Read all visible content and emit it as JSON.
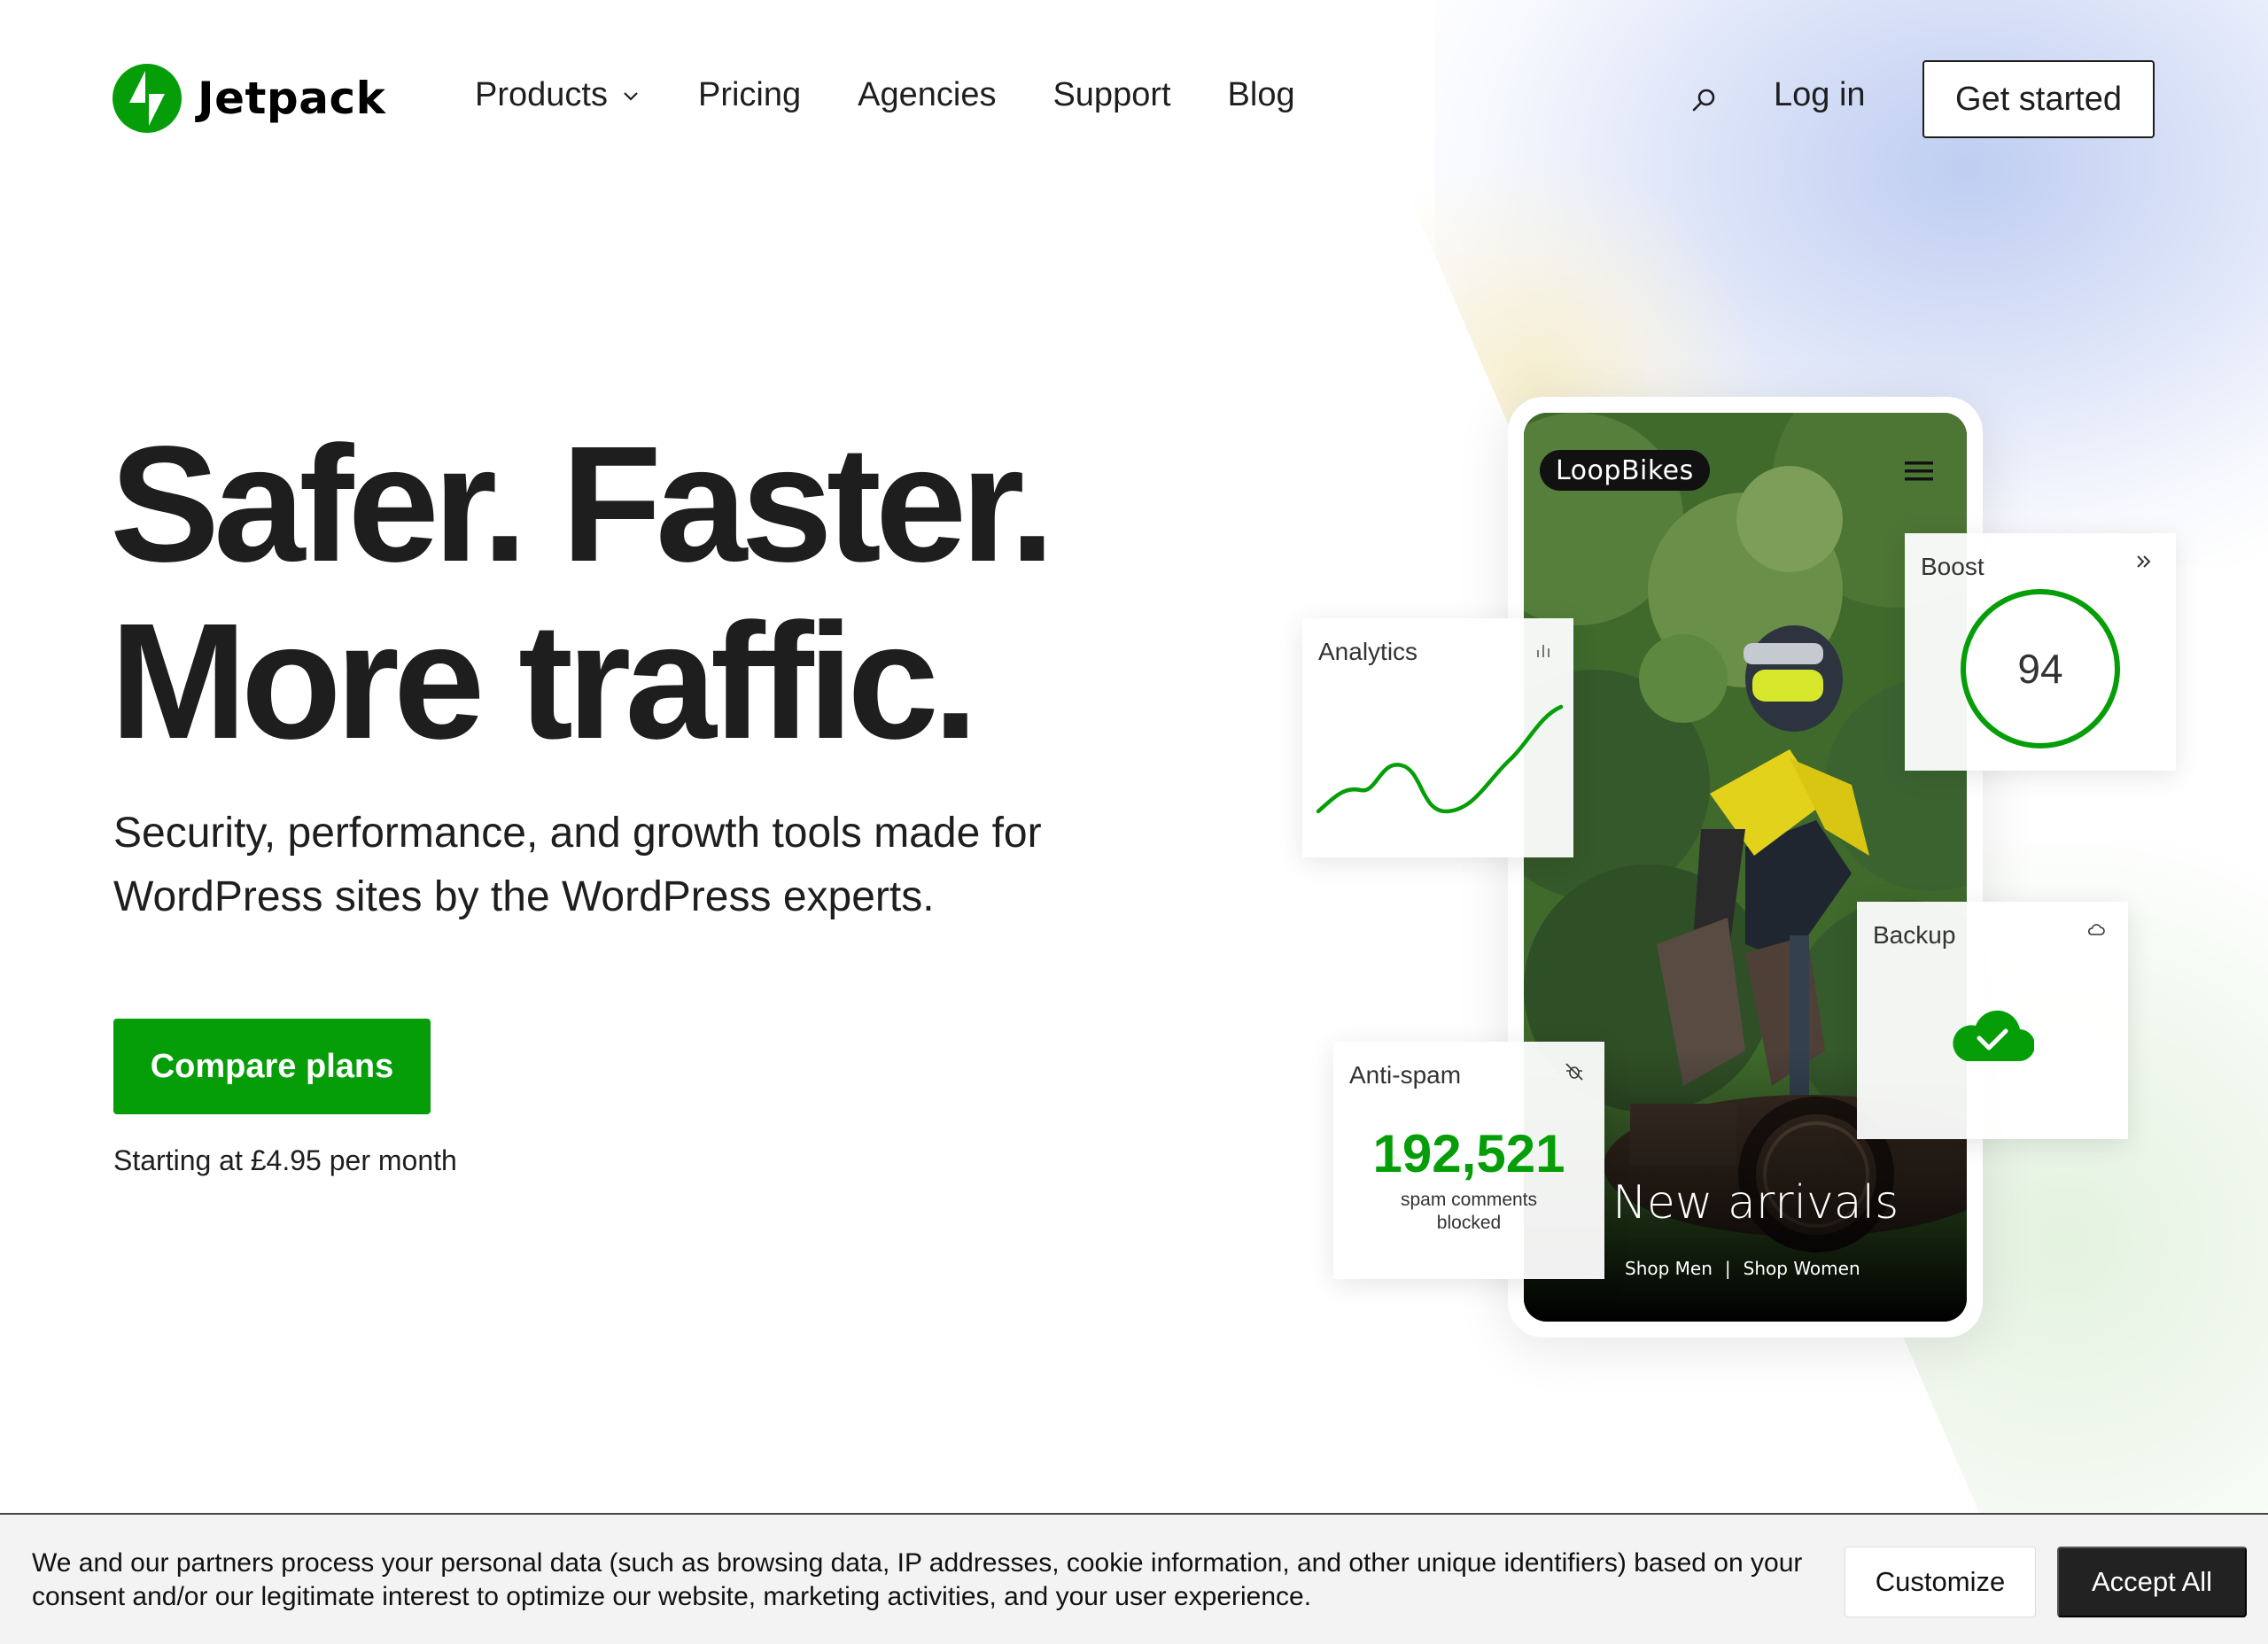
{
  "brand": {
    "name": "Jetpack",
    "accent": "#069e08"
  },
  "nav": {
    "items": [
      {
        "label": "Products",
        "has_dropdown": true
      },
      {
        "label": "Pricing"
      },
      {
        "label": "Agencies"
      },
      {
        "label": "Support"
      },
      {
        "label": "Blog"
      }
    ],
    "login": "Log in",
    "get_started": "Get started"
  },
  "hero": {
    "title_line1": "Safer. Faster.",
    "title_line2": "More traffic.",
    "subtitle_line1": "Security, performance, and growth tools made for",
    "subtitle_line2": "WordPress sites by the WordPress experts.",
    "cta": "Compare plans",
    "price_note": "Starting at £4.95 per month"
  },
  "mockup": {
    "store_name": "LoopBikes",
    "headline": "New arrivals",
    "link_men": "Shop Men",
    "separator": "|",
    "link_women": "Shop Women"
  },
  "cards": {
    "analytics": {
      "title": "Analytics",
      "icon": "bar-chart-icon"
    },
    "boost": {
      "title": "Boost",
      "score": "94",
      "score_percent": 100,
      "icon": "chevrons-right-icon"
    },
    "backup": {
      "title": "Backup",
      "icon": "cloud-icon"
    },
    "antispam": {
      "title": "Anti-spam",
      "count": "192,521",
      "label": "spam comments blocked",
      "icon": "spam-bug-icon"
    }
  },
  "cookie": {
    "text": "We and our partners process your personal data (such as browsing data, IP addresses, cookie information, and other unique identifiers) based on your consent and/or our legitimate interest to optimize our website, marketing activities, and your user experience.",
    "customize": "Customize",
    "accept": "Accept All"
  }
}
